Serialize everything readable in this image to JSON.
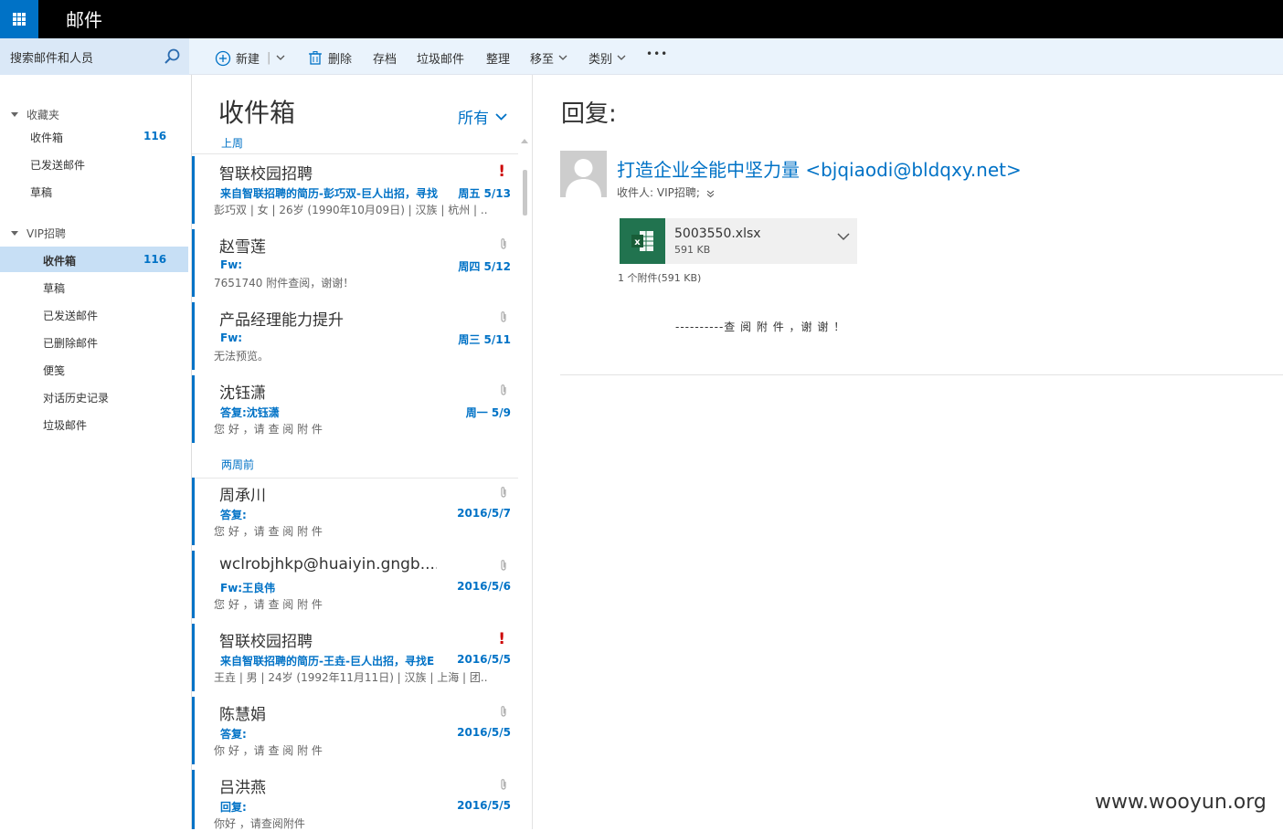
{
  "app": {
    "title": "邮件"
  },
  "search": {
    "placeholder": "搜索邮件和人员"
  },
  "toolbar": {
    "new_label": "新建",
    "delete_label": "删除",
    "archive_label": "存档",
    "junk_label": "垃圾邮件",
    "sweep_label": "整理",
    "moveto_label": "移至",
    "categories_label": "类别",
    "more_label": "•••"
  },
  "nav": {
    "favorites": {
      "header": "收藏夹",
      "items": [
        {
          "label": "收件箱",
          "count": "116"
        },
        {
          "label": "已发送邮件",
          "count": ""
        },
        {
          "label": "草稿",
          "count": ""
        }
      ]
    },
    "account": {
      "header": "VIP招聘",
      "items": [
        {
          "label": "收件箱",
          "count": "116"
        },
        {
          "label": "草稿",
          "count": ""
        },
        {
          "label": "已发送邮件",
          "count": ""
        },
        {
          "label": "已删除邮件",
          "count": ""
        },
        {
          "label": "便笺",
          "count": ""
        },
        {
          "label": "对话历史记录",
          "count": ""
        },
        {
          "label": "垃圾邮件",
          "count": ""
        }
      ]
    }
  },
  "list": {
    "title": "收件箱",
    "filter": "所有",
    "sections": {
      "last_week": "上周",
      "two_weeks": "两周前"
    },
    "messages": [
      {
        "sender": "智联校园招聘",
        "subject": "来自智联招聘的简历-彭巧双-巨人出招，寻找",
        "date": "周五 5/13",
        "preview": "彭巧双 | 女 | 26岁 (1990年10月09日) | 汉族 | 杭州 | ...",
        "flag": "!"
      },
      {
        "sender": "赵雪莲",
        "subject": "Fw:",
        "date": "周四 5/12",
        "preview": "7651740 附件查阅，谢谢！"
      },
      {
        "sender": "产品经理能力提升",
        "subject": "Fw:",
        "date": "周三 5/11",
        "preview": "无法预览。"
      },
      {
        "sender": "沈钰潇",
        "subject": "答复:沈钰潇",
        "date": "周一 5/9",
        "preview": "您 好 ，请 查 阅 附 件"
      },
      {
        "sender": "周承川",
        "subject": "答复:",
        "date": "2016/5/7",
        "preview": "您 好 ，请 查 阅 附 件"
      },
      {
        "sender": "wclrobjhkp@huaiyin.gngb....",
        "subject": "Fw:王良伟",
        "date": "2016/5/6",
        "preview": "您 好 ，请 查 阅 附 件"
      },
      {
        "sender": "智联校园招聘",
        "subject": "来自智联招聘的简历-王垚-巨人出招，寻找E",
        "date": "2016/5/5",
        "preview": "王垚 | 男 | 24岁 (1992年11月11日) | 汉族 | 上海 | 团...",
        "flag": "!"
      },
      {
        "sender": "陈慧娟",
        "subject": "答复:",
        "date": "2016/5/5",
        "preview": "你 好 ，请 查 阅 附 件"
      },
      {
        "sender": "吕洪燕",
        "subject": "回复:",
        "date": "2016/5/5",
        "preview": "你好 ，请查阅附件"
      }
    ]
  },
  "reading": {
    "title": "回复:",
    "from": "打造企业全能中坚力量 <bjqiaodi@bldqxy.net>",
    "to": "收件人: VIP招聘;",
    "attachment": {
      "name": "5003550.xlsx",
      "size": "591 KB"
    },
    "attachment_summary": "1 个附件(591 KB)",
    "body": "----------查 阅 附 件 ，谢 谢 ！"
  },
  "watermark": "www.wooyun.org",
  "colors": {
    "accent": "#0072c6",
    "topbar": "#000000",
    "selected": "#c7dff5",
    "excel": "#21734f",
    "flag": "#cc0000"
  }
}
